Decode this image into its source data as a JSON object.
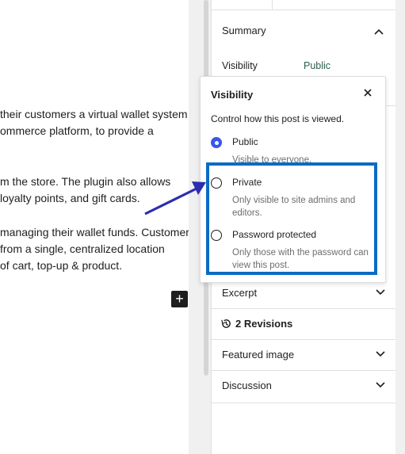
{
  "editor": {
    "paragraphs": [
      {
        "lines": [
          "their customers a virtual wallet system",
          "ommerce platform, to provide a"
        ]
      },
      {
        "lines": [
          "m the store. The plugin also allows",
          "loyalty points, and gift cards."
        ]
      },
      {
        "lines": [
          "managing their wallet funds. Customers",
          "from a single, centralized location",
          "of cart, top-up & product."
        ]
      }
    ],
    "add_block_label": "+"
  },
  "sidebar": {
    "summary": {
      "title": "Summary",
      "visibility_label": "Visibility",
      "visibility_value": "Public",
      "chevron": "up"
    },
    "panels": [
      {
        "title": "Excerpt",
        "chevron": "down"
      },
      {
        "title": "2 Revisions",
        "icon": "history-icon"
      },
      {
        "title": "Featured image",
        "chevron": "down"
      },
      {
        "title": "Discussion",
        "chevron": "down"
      }
    ]
  },
  "popover": {
    "title": "Visibility",
    "description": "Control how this post is viewed.",
    "close_icon": "close-icon",
    "options": [
      {
        "label": "Public",
        "help": "Visible to everyone.",
        "checked": true
      },
      {
        "label": "Private",
        "help": "Only visible to site admins and editors.",
        "checked": false
      },
      {
        "label": "Password protected",
        "help": "Only those with the password can view this post.",
        "checked": false
      }
    ]
  },
  "annotation": {
    "highlight_color": "#0a6bc4",
    "arrow_color": "#2a2fb0"
  },
  "colors": {
    "accent": "#3858e9",
    "visibility_value": "#2f5e50"
  }
}
